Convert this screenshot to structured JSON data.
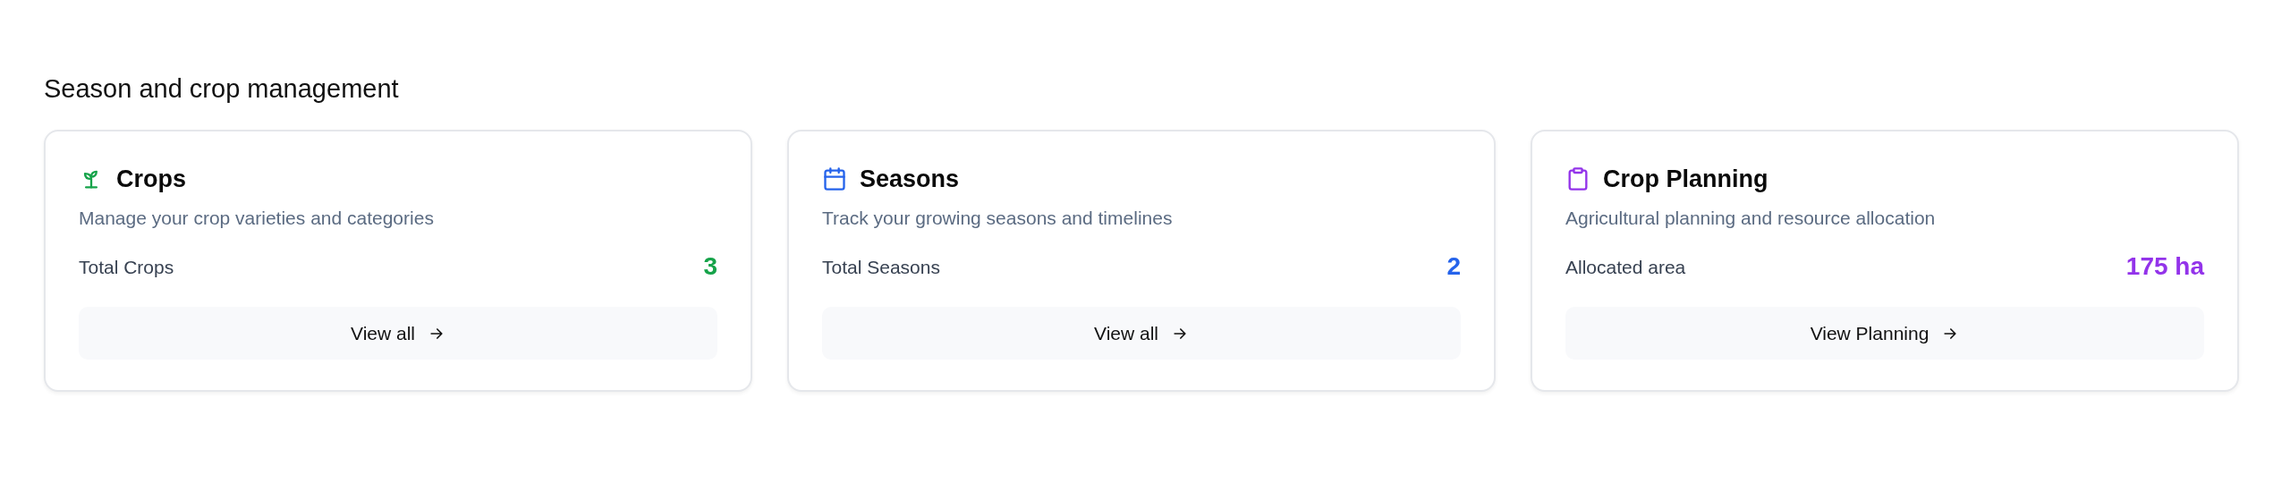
{
  "section_title": "Season and crop management",
  "cards": [
    {
      "kind": "sprout",
      "color": "#16a34a",
      "title": "Crops",
      "description": "Manage your crop varieties and categories",
      "stat_label": "Total Crops",
      "stat_value": "3",
      "button": "View all"
    },
    {
      "kind": "calendar",
      "color": "#2563eb",
      "title": "Seasons",
      "description": "Track your growing seasons and timelines",
      "stat_label": "Total Seasons",
      "stat_value": "2",
      "button": "View all"
    },
    {
      "kind": "clipboard",
      "color": "#9333ea",
      "title": "Crop Planning",
      "description": "Agricultural planning and resource allocation",
      "stat_label": "Allocated area",
      "stat_value": "175 ha",
      "button": "View Planning"
    }
  ]
}
